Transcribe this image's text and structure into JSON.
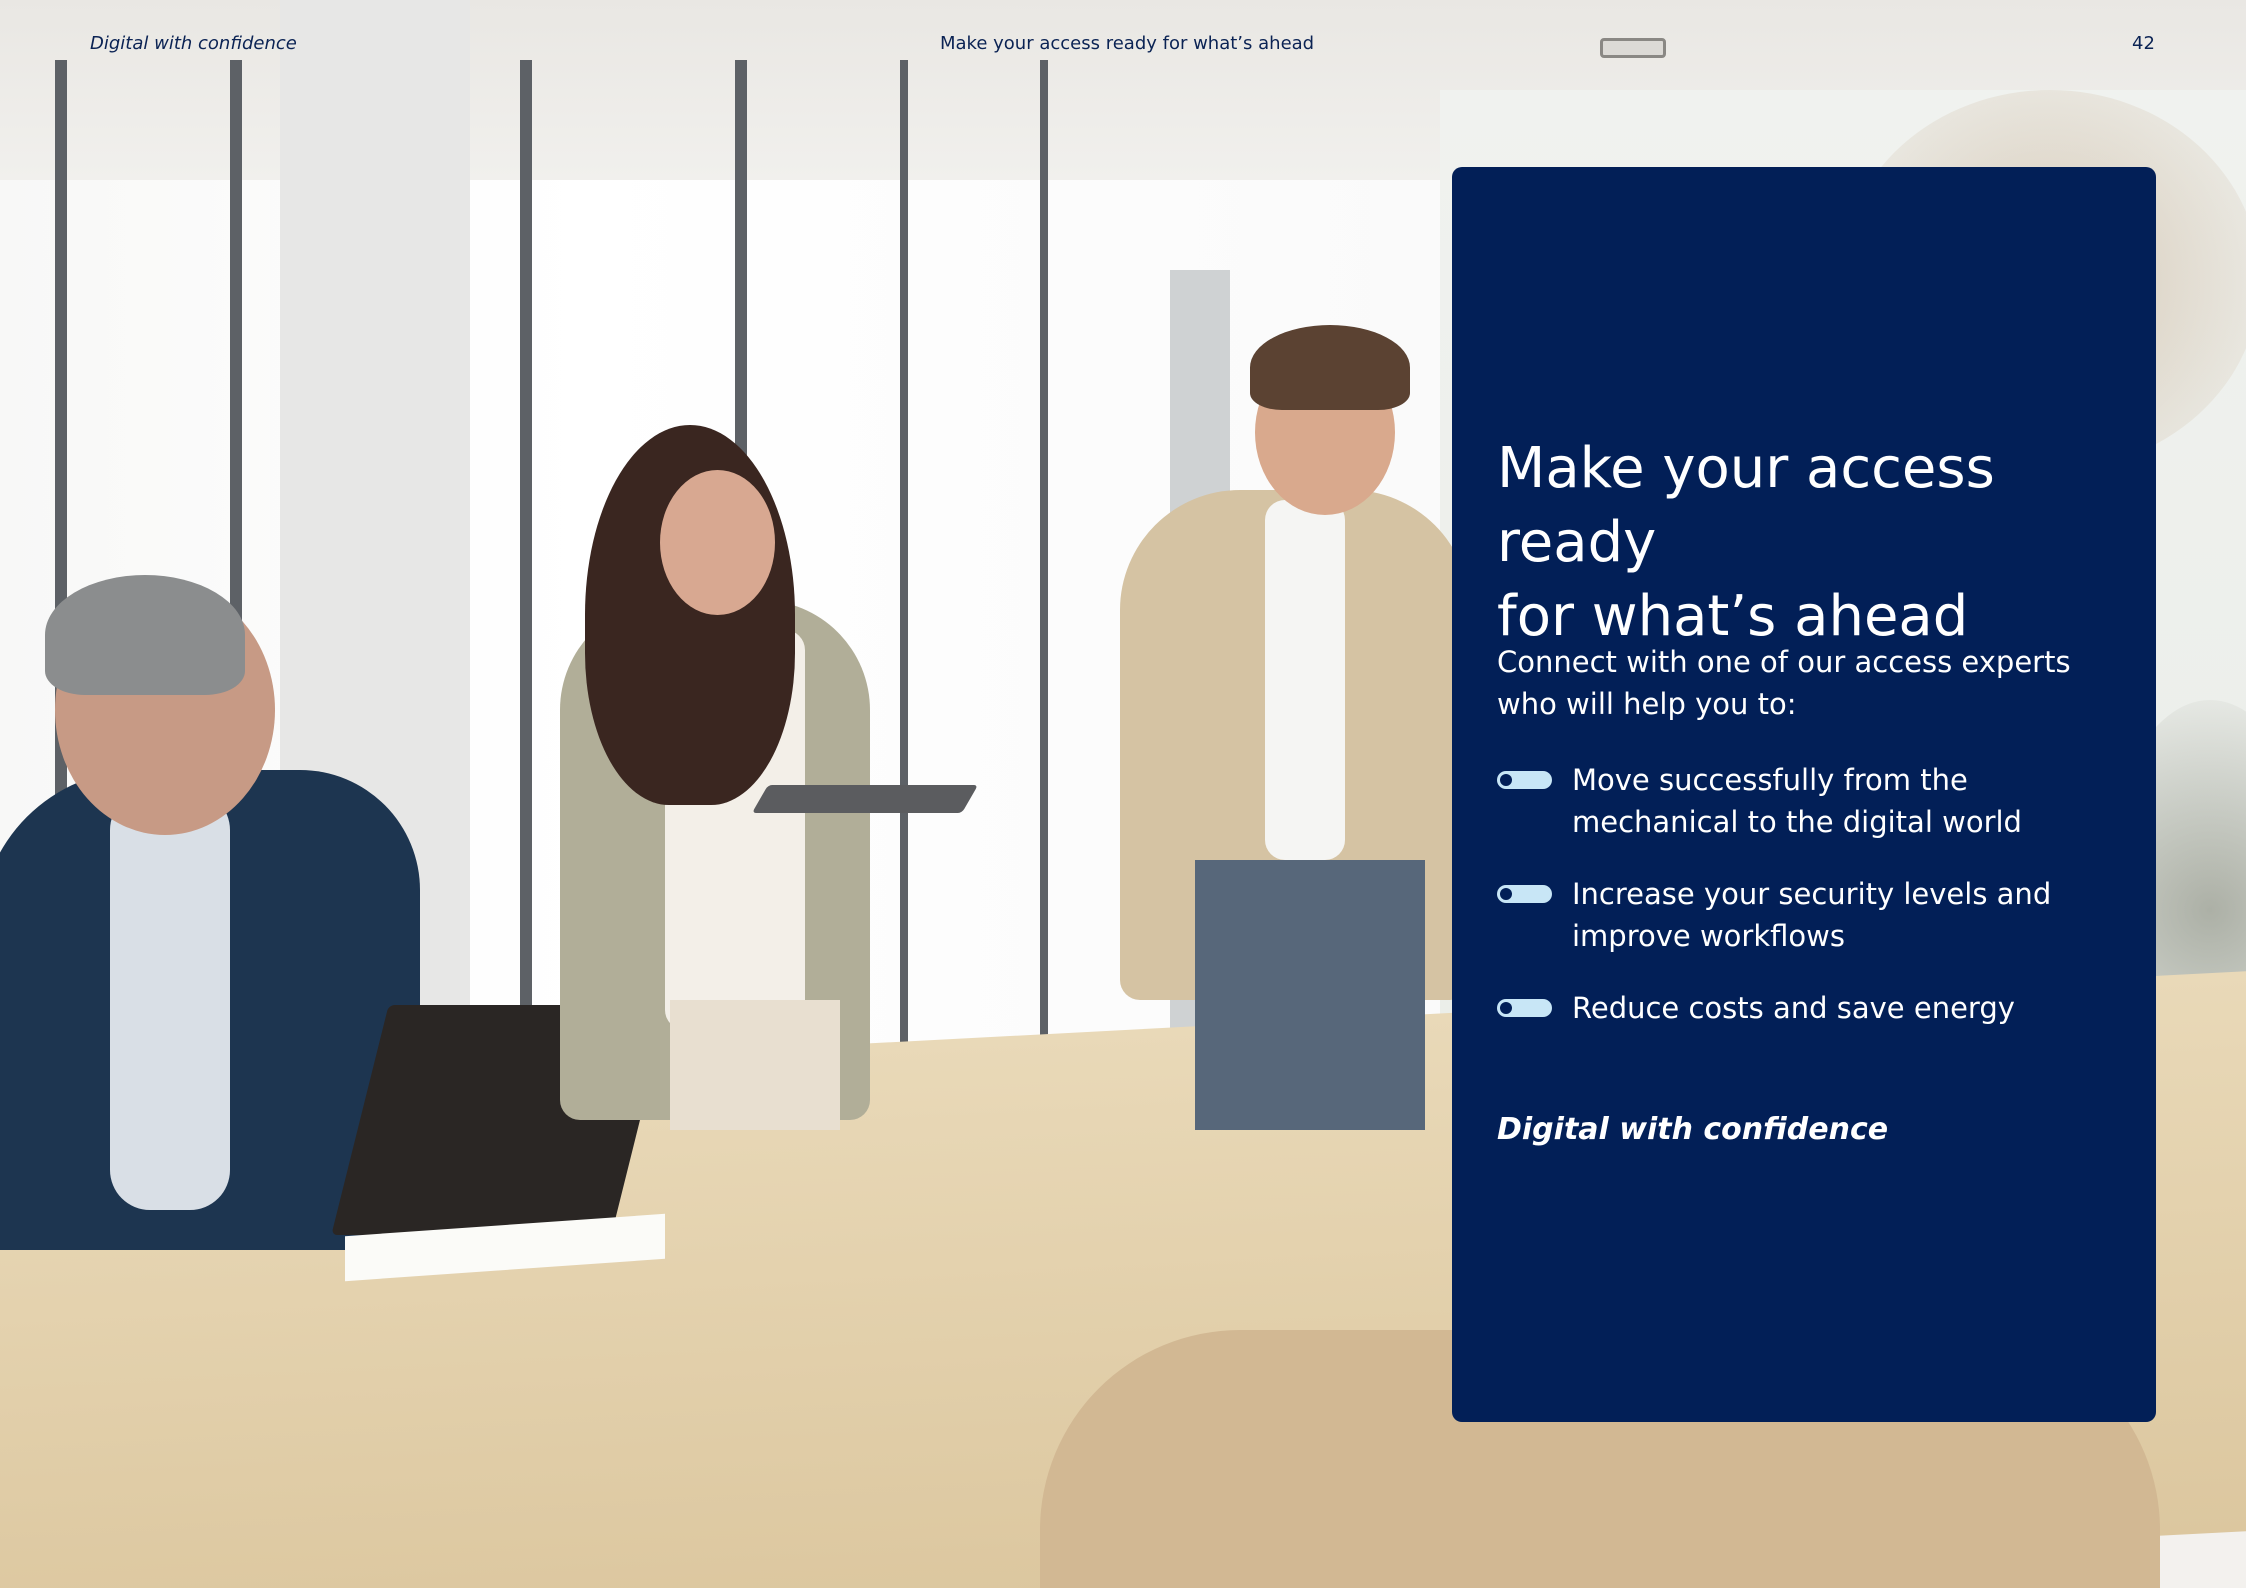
{
  "header": {
    "left_text": "Digital with confidence",
    "center_text": "Make your access ready for what’s ahead",
    "page_number": "42"
  },
  "panel": {
    "title_line1": "Make your access ready",
    "title_line2": "for what’s ahead",
    "intro_line1": "Connect with one of our access experts",
    "intro_line2": "who will help you to:",
    "bullets": [
      {
        "line1": "Move successfully from the",
        "line2": "mechanical to the digital world"
      },
      {
        "line1": "Increase your security levels and",
        "line2": "improve workflows"
      },
      {
        "line1": "Reduce costs and save energy",
        "line2": ""
      }
    ],
    "tagline": "Digital with confidence"
  },
  "colors": {
    "panel_bg": "#021f57",
    "toggle": "#c8e6f6",
    "header_text": "#0b2354"
  }
}
